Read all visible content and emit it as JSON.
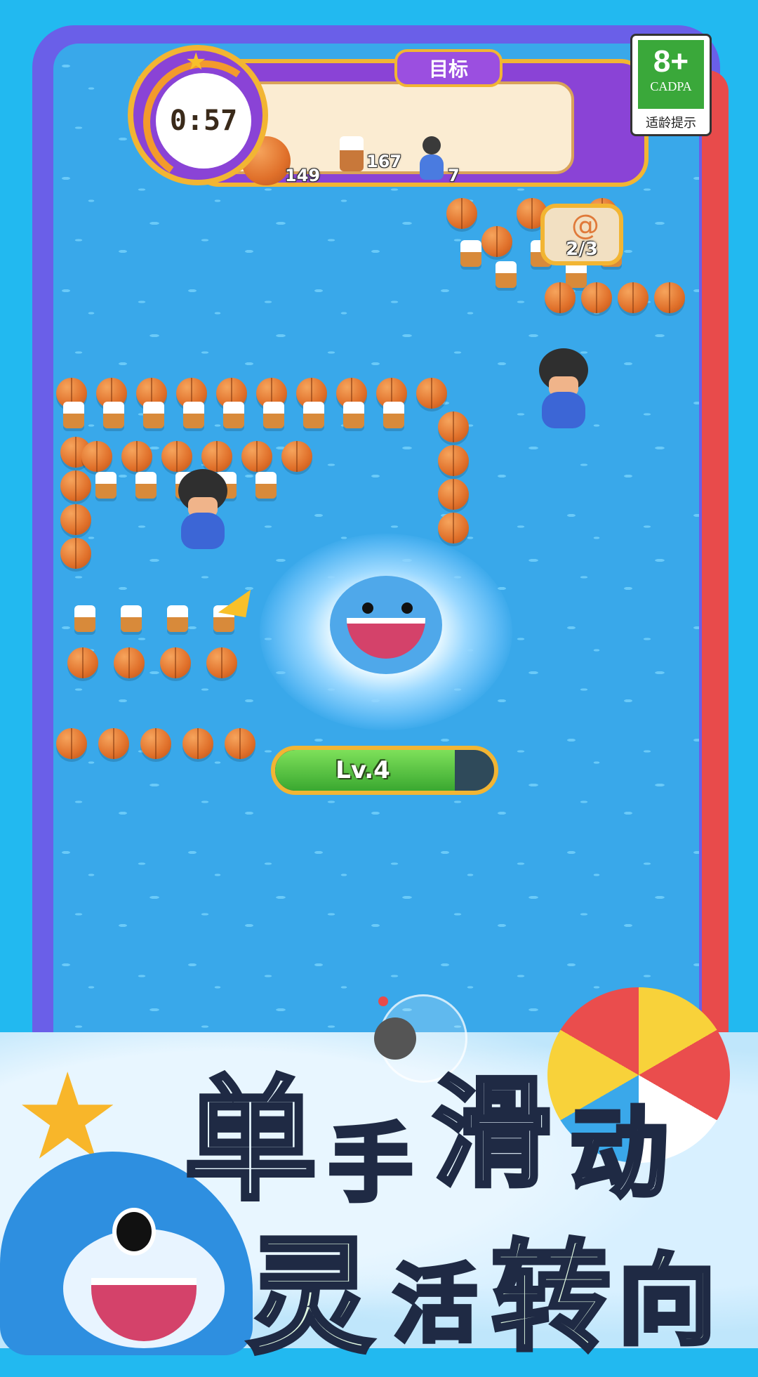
{
  "hud": {
    "timer": "0:57",
    "goal_title": "目标",
    "goals": [
      {
        "icon": "basketball-icon",
        "count": "149"
      },
      {
        "icon": "cup-icon",
        "count": "167"
      },
      {
        "icon": "person-icon",
        "count": "7"
      }
    ]
  },
  "rating": {
    "age": "8+",
    "org": "CADPA",
    "tip": "适龄提示"
  },
  "collectible": {
    "icon": "shell-icon",
    "progress": "2/3"
  },
  "player": {
    "level": "Lv.4",
    "level_progress": 0.82
  },
  "promo": {
    "line1": [
      "单",
      "手",
      "滑",
      "动"
    ],
    "line2": [
      "灵",
      "活",
      "转",
      "向"
    ]
  },
  "colors": {
    "water": "#39a8ea",
    "frame": "#6a5fe8",
    "accent": "#f2b533",
    "hud": "#8a43d6"
  }
}
